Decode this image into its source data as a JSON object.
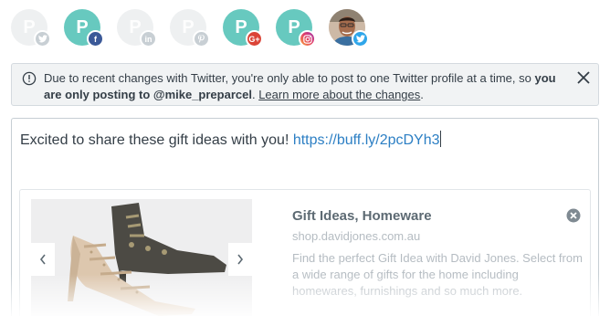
{
  "profiles": [
    {
      "service": "twitter",
      "selected": false,
      "badge_icon": "twitter-icon"
    },
    {
      "service": "facebook",
      "selected": true,
      "badge_icon": "facebook-icon"
    },
    {
      "service": "linkedin",
      "selected": false,
      "badge_icon": "linkedin-icon"
    },
    {
      "service": "pinterest",
      "selected": false,
      "badge_icon": "pinterest-icon"
    },
    {
      "service": "google-plus",
      "selected": true,
      "badge_icon": "google-plus-icon"
    },
    {
      "service": "instagram",
      "selected": true,
      "badge_icon": "instagram-icon"
    },
    {
      "service": "twitter",
      "selected": true,
      "badge_icon": "twitter-icon",
      "avatar": "photo"
    }
  ],
  "badges": {
    "fb": "f",
    "in": "in",
    "gp": "G+"
  },
  "notice": {
    "text_before": "Due to recent changes with Twitter, you're only able to post to one Twitter profile at a time, so ",
    "text_bold": "you are only posting to @mike_preparcel",
    "text_after": ". ",
    "link": "Learn more about the changes",
    "end": "."
  },
  "composer": {
    "text": "Excited to share these gift ideas with you! ",
    "link": "https://buff.ly/2pcDYh3"
  },
  "preview": {
    "title": "Gift Ideas, Homeware",
    "domain": "shop.davidjones.com.au",
    "description": "Find the perfect Gift Idea with David Jones. Select from a wide range of gifts for the home including homewares, furnishings and so much more."
  },
  "colors": {
    "brand_teal": "#67c9bf",
    "twitter": "#2fa6ea",
    "facebook": "#3b5998",
    "google_plus": "#db4437",
    "link": "#2c7fc4"
  }
}
